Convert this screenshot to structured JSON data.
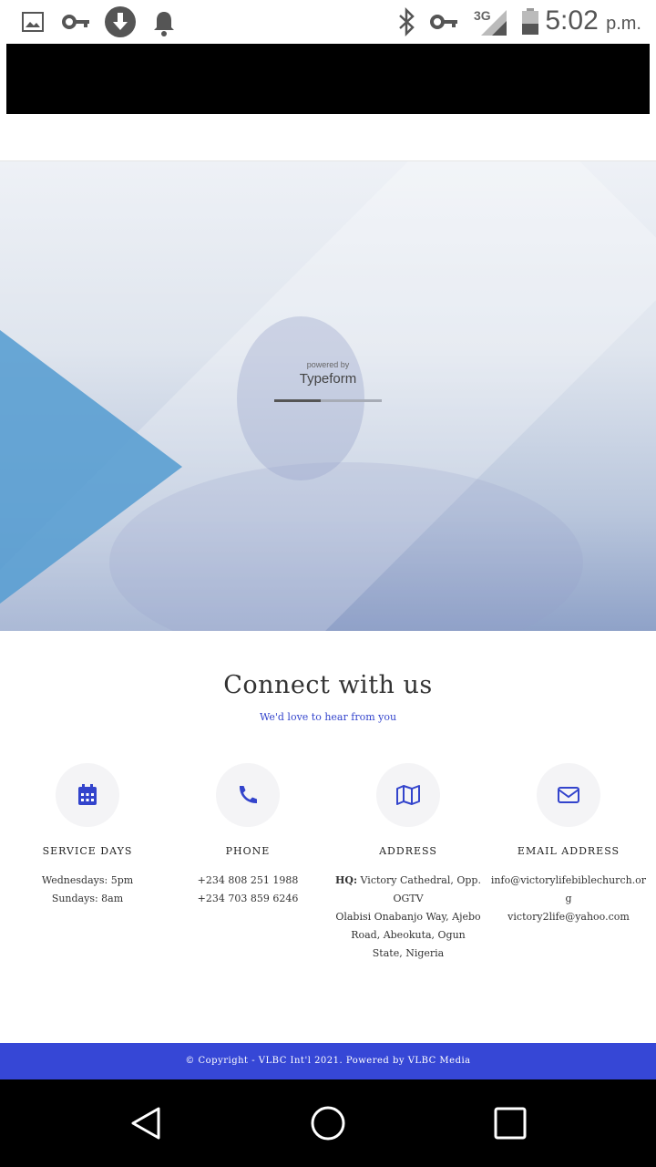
{
  "status_bar": {
    "network": "3G",
    "time": "5:02",
    "ampm": "p.m."
  },
  "typeform": {
    "powered_by": "powered by",
    "brand": "Typeform",
    "progress_percent": 43
  },
  "connect": {
    "title": "Connect with us",
    "subtitle": "We'd love to hear from you"
  },
  "contact_cards": [
    {
      "icon": "calendar-icon",
      "title": "SERVICE DAYS",
      "lines": [
        "Wednesdays: 5pm",
        "Sundays: 8am"
      ]
    },
    {
      "icon": "phone-icon",
      "title": "PHONE",
      "lines": [
        "+234 808 251 1988",
        "+234 703 859 6246"
      ]
    },
    {
      "icon": "map-icon",
      "title": "ADDRESS",
      "hq_label": "HQ:",
      "lines": [
        " Victory Cathedral, Opp. OGTV",
        "Olabisi Onabanjo Way, Ajebo Road, Abeokuta, Ogun State, Nigeria"
      ]
    },
    {
      "icon": "envelope-icon",
      "title": "EMAIL ADDRESS",
      "lines": [
        "info@victorylifebiblechurch.org",
        "victory2life@yahoo.com"
      ]
    }
  ],
  "footer": {
    "text": "© Copyright - VLBC Int'l 2021. Powered by VLBC Media"
  },
  "colors": {
    "accent": "#3647d6",
    "icon": "#3344cc"
  }
}
